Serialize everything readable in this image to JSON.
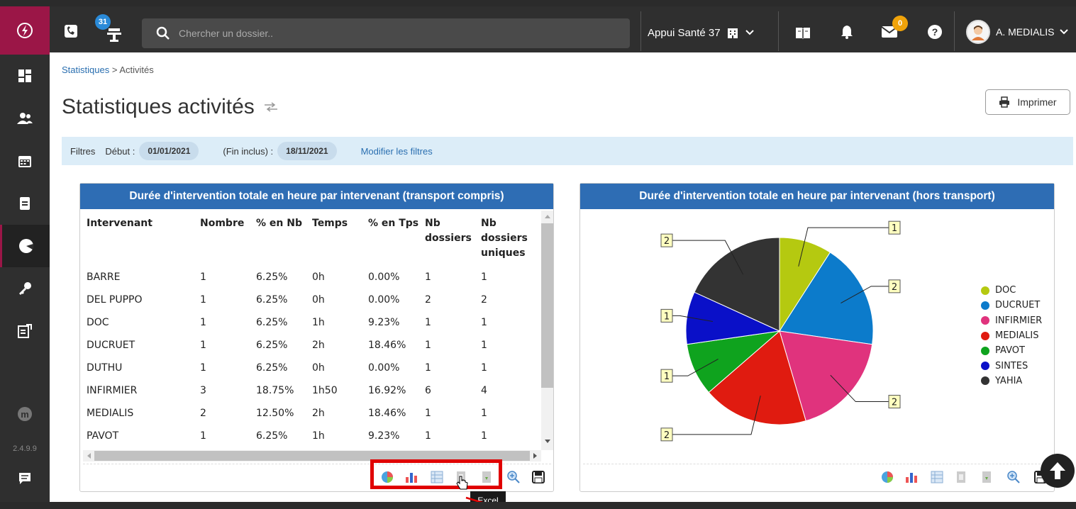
{
  "topbar": {
    "phone_badge": "31",
    "search_placeholder": "Chercher un dossier..",
    "org_name": "Appui Santé 37",
    "mail_badge": "0",
    "user_name": "A. MEDIALIS"
  },
  "sidebar": {
    "items": [
      "dashboard-icon",
      "users-icon",
      "calendar-icon",
      "document-icon",
      "statistics-icon",
      "key-icon",
      "export-icon"
    ],
    "version": "2.4.9.9"
  },
  "breadcrumb": {
    "parent": "Statistiques",
    "separator": ">",
    "current": "Activités"
  },
  "page": {
    "title": "Statistiques activités",
    "print_label": "Imprimer"
  },
  "filters": {
    "label": "Filtres",
    "start_label": "Début :",
    "start_value": "01/01/2021",
    "end_label": "(Fin inclus) :",
    "end_value": "18/11/2021",
    "modify_link": "Modifier les filtres"
  },
  "panel_left": {
    "title": "Durée d'intervention totale en heure par intervenant (transport compris)",
    "headers": [
      "Intervenant",
      "Nombre",
      "% en Nb",
      "Temps",
      "% en Tps",
      "Nb dossiers",
      "Nb dossiers uniques"
    ],
    "rows": [
      [
        "BARRE",
        "1",
        "6.25%",
        "0h",
        "0.00%",
        "1",
        "1"
      ],
      [
        "DEL PUPPO",
        "1",
        "6.25%",
        "0h",
        "0.00%",
        "2",
        "2"
      ],
      [
        "DOC",
        "1",
        "6.25%",
        "1h",
        "9.23%",
        "1",
        "1"
      ],
      [
        "DUCRUET",
        "1",
        "6.25%",
        "2h",
        "18.46%",
        "1",
        "1"
      ],
      [
        "DUTHU",
        "1",
        "6.25%",
        "0h",
        "0.00%",
        "1",
        "1"
      ],
      [
        "INFIRMIER",
        "3",
        "18.75%",
        "1h50",
        "16.92%",
        "6",
        "4"
      ],
      [
        "MEDIALIS",
        "2",
        "12.50%",
        "2h",
        "18.46%",
        "1",
        "1"
      ],
      [
        "PAVOT",
        "1",
        "6.25%",
        "1h",
        "9.23%",
        "1",
        "1"
      ]
    ],
    "tooltip": "Excel"
  },
  "panel_right": {
    "title": "Durée d'intervention totale en heure par intervenant (hors transport)"
  },
  "chart_data": {
    "type": "pie",
    "title": "Durée d'intervention totale en heure par intervenant (hors transport)",
    "categories": [
      "DOC",
      "DUCRUET",
      "INFIRMIER",
      "MEDIALIS",
      "PAVOT",
      "SINTES",
      "YAHIA"
    ],
    "values": [
      1,
      2,
      2,
      2,
      1,
      1,
      2
    ],
    "colors": [
      "#b5c910",
      "#0c7bcb",
      "#e0337d",
      "#e01b10",
      "#0fa31e",
      "#0a10c8",
      "#333333"
    ],
    "legend_position": "right"
  }
}
